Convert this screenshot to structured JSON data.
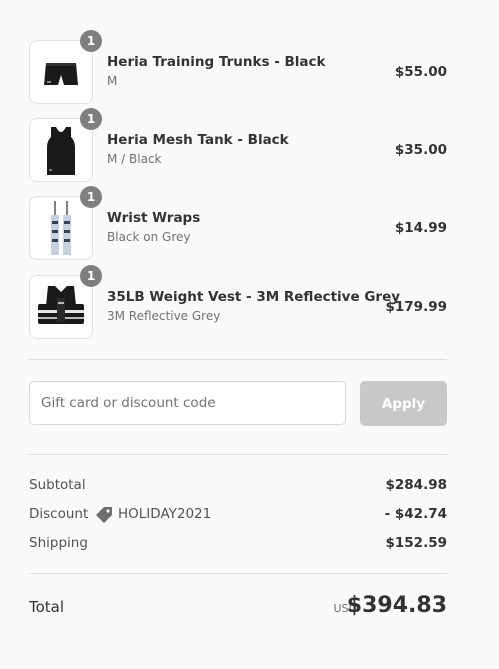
{
  "items": [
    {
      "title": "Heria Training Trunks - Black",
      "variant": "M",
      "price": "$55.00",
      "quantity": "1",
      "image_icon": "shorts-icon"
    },
    {
      "title": "Heria Mesh Tank - Black",
      "variant": "M / Black",
      "price": "$35.00",
      "quantity": "1",
      "image_icon": "tank-top-icon"
    },
    {
      "title": "Wrist Wraps",
      "variant": "Black on Grey",
      "price": "$14.99",
      "quantity": "1",
      "image_icon": "wrist-wraps-icon"
    },
    {
      "title": "35LB Weight Vest - 3M Reflective Grey",
      "variant": "3M Reflective Grey",
      "price": "$179.99",
      "quantity": "1",
      "image_icon": "weight-vest-icon"
    }
  ],
  "discount": {
    "placeholder": "Gift card or discount code",
    "value": "",
    "apply_label": "Apply"
  },
  "totals": {
    "subtotal_label": "Subtotal",
    "subtotal_value": "$284.98",
    "discount_label": "Discount",
    "discount_code": "HOLIDAY2021",
    "discount_value": "- $42.74",
    "shipping_label": "Shipping",
    "shipping_value": "$152.59",
    "total_label": "Total",
    "currency": "USD",
    "total_value": "$394.83"
  },
  "colors": {
    "background": "#fafafa",
    "badge": "#7f7f7f",
    "apply_button_disabled": "#c8c8c8",
    "divider": "#dedede"
  }
}
